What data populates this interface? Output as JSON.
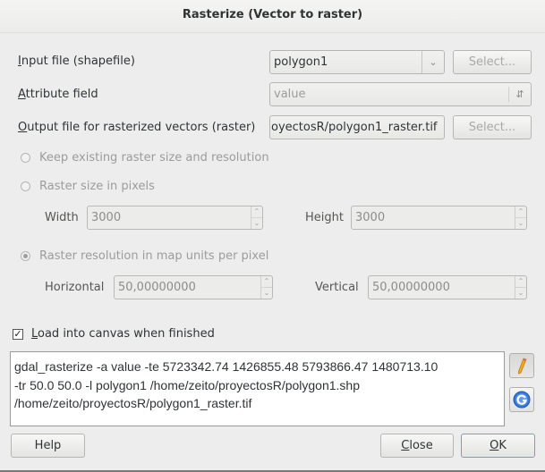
{
  "window": {
    "title": "Rasterize (Vector to raster)"
  },
  "form": {
    "input_file": {
      "label_mnemonic": "I",
      "label_rest": "nput file (shapefile)",
      "value": "polygon1",
      "select_label": "Select..."
    },
    "attribute_field": {
      "label_mnemonic": "A",
      "label_rest": "ttribute field",
      "value": "value"
    },
    "output_file": {
      "label_mnemonic": "O",
      "label_rest": "utput file for rasterized vectors (raster)",
      "value": "oyectosR/polygon1_raster.tif",
      "select_label": "Select..."
    },
    "options": {
      "keep_existing": {
        "label": "Keep existing raster size and resolution",
        "checked": false
      },
      "size_in_pixels": {
        "label": "Raster size in pixels",
        "checked": false,
        "width_label": "Width",
        "width_value": "3000",
        "height_label": "Height",
        "height_value": "3000"
      },
      "resolution": {
        "label": "Raster resolution in map units per pixel",
        "checked": true,
        "horizontal_label": "Horizontal",
        "horizontal_value": "50,00000000",
        "vertical_label": "Vertical",
        "vertical_value": "50,00000000"
      }
    },
    "load_canvas": {
      "label_mnemonic": "L",
      "label_rest": "oad into canvas when finished",
      "checked": true
    }
  },
  "command": {
    "lines": [
      "gdal_rasterize -a value -te 5723342.74 1426855.48  5793866.47 1480713.10",
      "-tr 50.0 50.0 -l polygon1 /home/zeito/proyectosR/polygon1.shp",
      "/home/zeito/proyectosR/polygon1_raster.tif"
    ],
    "edit_icon": "pencil-icon",
    "reset_icon": "reset-icon"
  },
  "buttons": {
    "help": "Help",
    "close_mnemonic": "C",
    "close_rest": "lose",
    "ok_mnemonic": "O",
    "ok_rest": "K"
  }
}
